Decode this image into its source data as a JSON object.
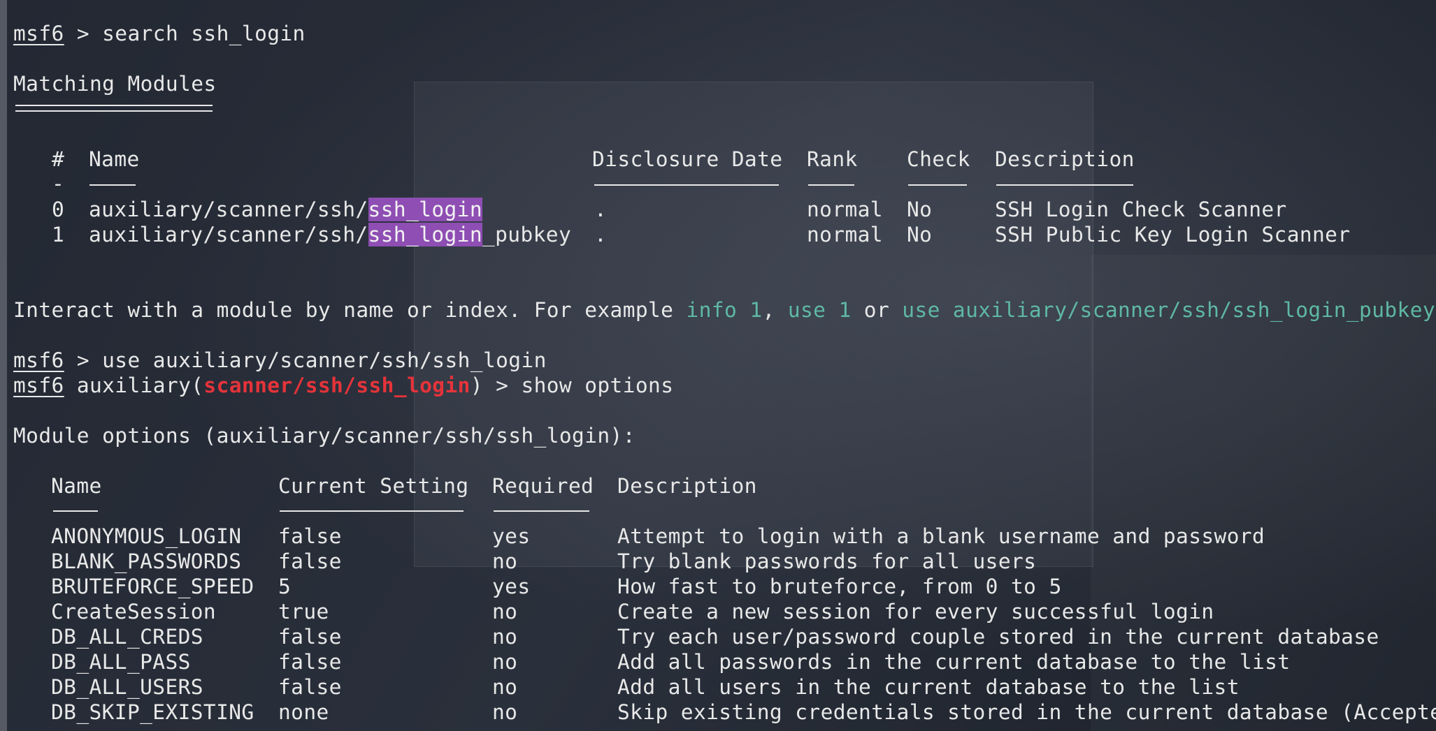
{
  "prompt": "msf6",
  "cmd_search": " > search ssh_login",
  "matching_title": "Matching Modules",
  "modules_table": {
    "headers": [
      "#",
      "Name",
      "Disclosure Date",
      "Rank",
      "Check",
      "Description"
    ],
    "num_sep": "-",
    "rows": [
      {
        "num": "0",
        "name_pre": "auxiliary/scanner/ssh/",
        "name_hl": "ssh_login",
        "name_post": "",
        "date": ".",
        "rank": "normal",
        "check": "No",
        "desc": "SSH Login Check Scanner"
      },
      {
        "num": "1",
        "name_pre": "auxiliary/scanner/ssh/",
        "name_hl": "ssh_login",
        "name_post": "_pubkey",
        "date": ".",
        "rank": "normal",
        "check": "No",
        "desc": "SSH Public Key Login Scanner"
      }
    ]
  },
  "interact": {
    "text1": "Interact with a module by name or index. For example ",
    "link1": "info 1",
    "text2": ", ",
    "link2": "use 1",
    "text3": " or ",
    "link3": "use auxiliary/scanner/ssh/ssh_login_pubkey"
  },
  "cmd_use": " > use auxiliary/scanner/ssh/ssh_login",
  "aux_prefix": " auxiliary(",
  "aux_module": "scanner/ssh/ssh_login",
  "aux_suffix": ") > show options",
  "options_title": "Module options (auxiliary/scanner/ssh/ssh_login):",
  "options_table": {
    "headers": [
      "Name",
      "Current Setting",
      "Required",
      "Description"
    ],
    "rows": [
      {
        "name": "ANONYMOUS_LOGIN",
        "setting": "false",
        "required": "yes",
        "desc": "Attempt to login with a blank username and password"
      },
      {
        "name": "BLANK_PASSWORDS",
        "setting": "false",
        "required": "no",
        "desc": "Try blank passwords for all users"
      },
      {
        "name": "BRUTEFORCE_SPEED",
        "setting": "5",
        "required": "yes",
        "desc": "How fast to bruteforce, from 0 to 5"
      },
      {
        "name": "CreateSession",
        "setting": "true",
        "required": "no",
        "desc": "Create a new session for every successful login"
      },
      {
        "name": "DB_ALL_CREDS",
        "setting": "false",
        "required": "no",
        "desc": "Try each user/password couple stored in the current database"
      },
      {
        "name": "DB_ALL_PASS",
        "setting": "false",
        "required": "no",
        "desc": "Add all passwords in the current database to the list"
      },
      {
        "name": "DB_ALL_USERS",
        "setting": "false",
        "required": "no",
        "desc": "Add all users in the current database to the list"
      },
      {
        "name": "DB_SKIP_EXISTING",
        "setting": "none",
        "required": "no",
        "desc": "Skip existing credentials stored in the current database (Accepte"
      }
    ]
  },
  "colors": {
    "background": "#1f2530",
    "text": "#e8e8e8",
    "highlight": "#8e4eb3",
    "link": "#5fb8a4",
    "module_red": "#e6333a"
  }
}
